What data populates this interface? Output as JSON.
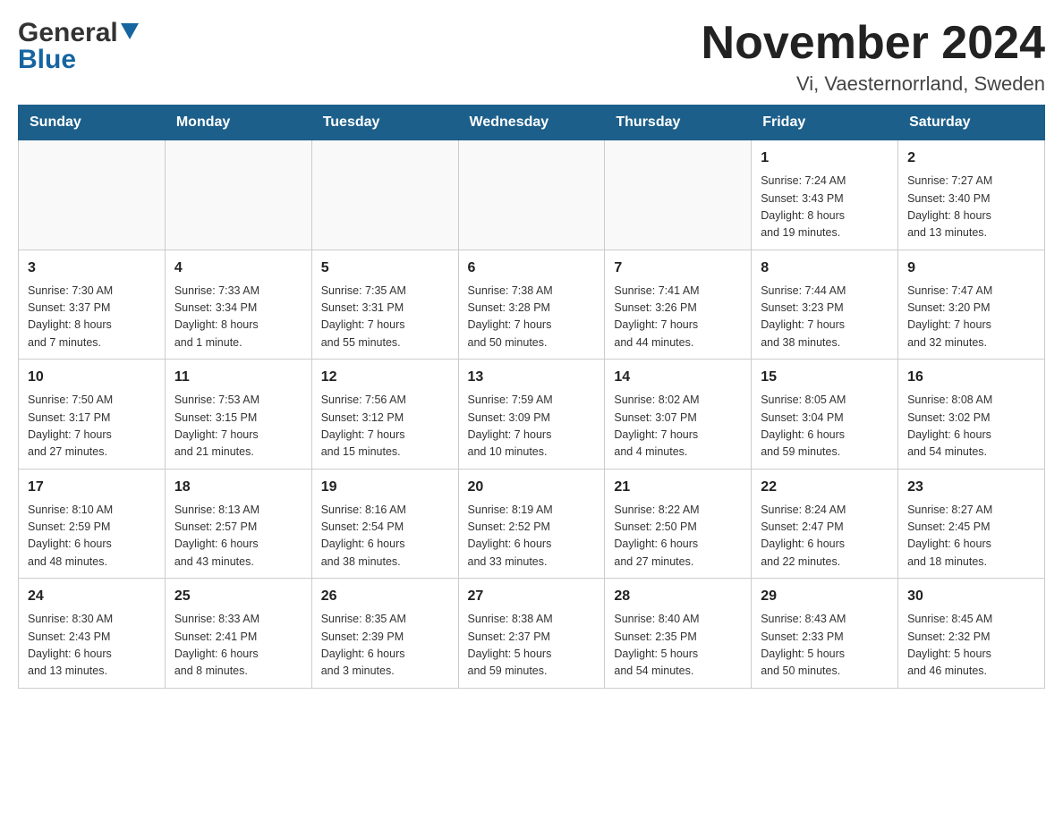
{
  "header": {
    "logo_general": "General",
    "logo_blue": "Blue",
    "month_title": "November 2024",
    "location": "Vi, Vaesternorrland, Sweden"
  },
  "days_of_week": [
    "Sunday",
    "Monday",
    "Tuesday",
    "Wednesday",
    "Thursday",
    "Friday",
    "Saturday"
  ],
  "weeks": [
    [
      {
        "day": "",
        "info": ""
      },
      {
        "day": "",
        "info": ""
      },
      {
        "day": "",
        "info": ""
      },
      {
        "day": "",
        "info": ""
      },
      {
        "day": "",
        "info": ""
      },
      {
        "day": "1",
        "info": "Sunrise: 7:24 AM\nSunset: 3:43 PM\nDaylight: 8 hours\nand 19 minutes."
      },
      {
        "day": "2",
        "info": "Sunrise: 7:27 AM\nSunset: 3:40 PM\nDaylight: 8 hours\nand 13 minutes."
      }
    ],
    [
      {
        "day": "3",
        "info": "Sunrise: 7:30 AM\nSunset: 3:37 PM\nDaylight: 8 hours\nand 7 minutes."
      },
      {
        "day": "4",
        "info": "Sunrise: 7:33 AM\nSunset: 3:34 PM\nDaylight: 8 hours\nand 1 minute."
      },
      {
        "day": "5",
        "info": "Sunrise: 7:35 AM\nSunset: 3:31 PM\nDaylight: 7 hours\nand 55 minutes."
      },
      {
        "day": "6",
        "info": "Sunrise: 7:38 AM\nSunset: 3:28 PM\nDaylight: 7 hours\nand 50 minutes."
      },
      {
        "day": "7",
        "info": "Sunrise: 7:41 AM\nSunset: 3:26 PM\nDaylight: 7 hours\nand 44 minutes."
      },
      {
        "day": "8",
        "info": "Sunrise: 7:44 AM\nSunset: 3:23 PM\nDaylight: 7 hours\nand 38 minutes."
      },
      {
        "day": "9",
        "info": "Sunrise: 7:47 AM\nSunset: 3:20 PM\nDaylight: 7 hours\nand 32 minutes."
      }
    ],
    [
      {
        "day": "10",
        "info": "Sunrise: 7:50 AM\nSunset: 3:17 PM\nDaylight: 7 hours\nand 27 minutes."
      },
      {
        "day": "11",
        "info": "Sunrise: 7:53 AM\nSunset: 3:15 PM\nDaylight: 7 hours\nand 21 minutes."
      },
      {
        "day": "12",
        "info": "Sunrise: 7:56 AM\nSunset: 3:12 PM\nDaylight: 7 hours\nand 15 minutes."
      },
      {
        "day": "13",
        "info": "Sunrise: 7:59 AM\nSunset: 3:09 PM\nDaylight: 7 hours\nand 10 minutes."
      },
      {
        "day": "14",
        "info": "Sunrise: 8:02 AM\nSunset: 3:07 PM\nDaylight: 7 hours\nand 4 minutes."
      },
      {
        "day": "15",
        "info": "Sunrise: 8:05 AM\nSunset: 3:04 PM\nDaylight: 6 hours\nand 59 minutes."
      },
      {
        "day": "16",
        "info": "Sunrise: 8:08 AM\nSunset: 3:02 PM\nDaylight: 6 hours\nand 54 minutes."
      }
    ],
    [
      {
        "day": "17",
        "info": "Sunrise: 8:10 AM\nSunset: 2:59 PM\nDaylight: 6 hours\nand 48 minutes."
      },
      {
        "day": "18",
        "info": "Sunrise: 8:13 AM\nSunset: 2:57 PM\nDaylight: 6 hours\nand 43 minutes."
      },
      {
        "day": "19",
        "info": "Sunrise: 8:16 AM\nSunset: 2:54 PM\nDaylight: 6 hours\nand 38 minutes."
      },
      {
        "day": "20",
        "info": "Sunrise: 8:19 AM\nSunset: 2:52 PM\nDaylight: 6 hours\nand 33 minutes."
      },
      {
        "day": "21",
        "info": "Sunrise: 8:22 AM\nSunset: 2:50 PM\nDaylight: 6 hours\nand 27 minutes."
      },
      {
        "day": "22",
        "info": "Sunrise: 8:24 AM\nSunset: 2:47 PM\nDaylight: 6 hours\nand 22 minutes."
      },
      {
        "day": "23",
        "info": "Sunrise: 8:27 AM\nSunset: 2:45 PM\nDaylight: 6 hours\nand 18 minutes."
      }
    ],
    [
      {
        "day": "24",
        "info": "Sunrise: 8:30 AM\nSunset: 2:43 PM\nDaylight: 6 hours\nand 13 minutes."
      },
      {
        "day": "25",
        "info": "Sunrise: 8:33 AM\nSunset: 2:41 PM\nDaylight: 6 hours\nand 8 minutes."
      },
      {
        "day": "26",
        "info": "Sunrise: 8:35 AM\nSunset: 2:39 PM\nDaylight: 6 hours\nand 3 minutes."
      },
      {
        "day": "27",
        "info": "Sunrise: 8:38 AM\nSunset: 2:37 PM\nDaylight: 5 hours\nand 59 minutes."
      },
      {
        "day": "28",
        "info": "Sunrise: 8:40 AM\nSunset: 2:35 PM\nDaylight: 5 hours\nand 54 minutes."
      },
      {
        "day": "29",
        "info": "Sunrise: 8:43 AM\nSunset: 2:33 PM\nDaylight: 5 hours\nand 50 minutes."
      },
      {
        "day": "30",
        "info": "Sunrise: 8:45 AM\nSunset: 2:32 PM\nDaylight: 5 hours\nand 46 minutes."
      }
    ]
  ]
}
